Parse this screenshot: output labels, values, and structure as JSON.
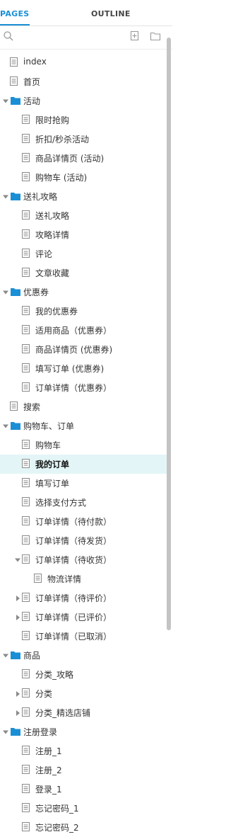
{
  "tabs": {
    "pages": "PAGES",
    "outline": "OUTLINE"
  },
  "toolbar": {
    "search_icon": "search-icon",
    "add_page_icon": "add-page-icon",
    "add_folder_icon": "add-folder-icon"
  },
  "colors": {
    "accent": "#1a8fd6",
    "folder": "#1a8fd6",
    "selected_bg": "#e3f5f7"
  },
  "tree": [
    {
      "label": "index",
      "kind": "page",
      "depth": 0
    },
    {
      "label": "首页",
      "kind": "page",
      "depth": 0
    },
    {
      "label": "活动",
      "kind": "folder",
      "depth": 0,
      "expanded": true
    },
    {
      "label": "限时抢购",
      "kind": "page",
      "depth": 1
    },
    {
      "label": "折扣/秒杀活动",
      "kind": "page",
      "depth": 1
    },
    {
      "label": "商品详情页 (活动)",
      "kind": "page",
      "depth": 1
    },
    {
      "label": "购物车 (活动)",
      "kind": "page",
      "depth": 1
    },
    {
      "label": "送礼攻略",
      "kind": "folder",
      "depth": 0,
      "expanded": true
    },
    {
      "label": "送礼攻略",
      "kind": "page",
      "depth": 1
    },
    {
      "label": "攻略详情",
      "kind": "page",
      "depth": 1
    },
    {
      "label": "评论",
      "kind": "page",
      "depth": 1
    },
    {
      "label": "文章收藏",
      "kind": "page",
      "depth": 1
    },
    {
      "label": "优惠券",
      "kind": "folder",
      "depth": 0,
      "expanded": true
    },
    {
      "label": "我的优惠券",
      "kind": "page",
      "depth": 1
    },
    {
      "label": "适用商品（优惠券）",
      "kind": "page",
      "depth": 1
    },
    {
      "label": "商品详情页 (优惠券)",
      "kind": "page",
      "depth": 1
    },
    {
      "label": "填写订单 (优惠券)",
      "kind": "page",
      "depth": 1
    },
    {
      "label": "订单详情（优惠券）",
      "kind": "page",
      "depth": 1
    },
    {
      "label": "搜索",
      "kind": "page",
      "depth": 0
    },
    {
      "label": "购物车、订单",
      "kind": "folder",
      "depth": 0,
      "expanded": true
    },
    {
      "label": "购物车",
      "kind": "page",
      "depth": 1
    },
    {
      "label": "我的订单",
      "kind": "page",
      "depth": 1,
      "selected": true
    },
    {
      "label": "填写订单",
      "kind": "page",
      "depth": 1
    },
    {
      "label": "选择支付方式",
      "kind": "page",
      "depth": 1
    },
    {
      "label": "订单详情（待付款）",
      "kind": "page",
      "depth": 1
    },
    {
      "label": "订单详情（待发货）",
      "kind": "page",
      "depth": 1
    },
    {
      "label": "订单详情（待收货）",
      "kind": "page",
      "depth": 1,
      "children": "expanded"
    },
    {
      "label": "物流详情",
      "kind": "page",
      "depth": 2
    },
    {
      "label": "订单详情（待评价）",
      "kind": "page",
      "depth": 1,
      "children": "collapsed"
    },
    {
      "label": "订单详情（已评价）",
      "kind": "page",
      "depth": 1,
      "children": "collapsed"
    },
    {
      "label": "订单详情（已取消）",
      "kind": "page",
      "depth": 1
    },
    {
      "label": "商品",
      "kind": "folder",
      "depth": 0,
      "expanded": true
    },
    {
      "label": "分类_攻略",
      "kind": "page",
      "depth": 1
    },
    {
      "label": "分类",
      "kind": "page",
      "depth": 1,
      "children": "collapsed"
    },
    {
      "label": "分类_精选店铺",
      "kind": "page",
      "depth": 1,
      "children": "collapsed"
    },
    {
      "label": "注册登录",
      "kind": "folder",
      "depth": 0,
      "expanded": true
    },
    {
      "label": "注册_1",
      "kind": "page",
      "depth": 1
    },
    {
      "label": "注册_2",
      "kind": "page",
      "depth": 1
    },
    {
      "label": "登录_1",
      "kind": "page",
      "depth": 1
    },
    {
      "label": "忘记密码_1",
      "kind": "page",
      "depth": 1
    },
    {
      "label": "忘记密码_2",
      "kind": "page",
      "depth": 1
    }
  ]
}
